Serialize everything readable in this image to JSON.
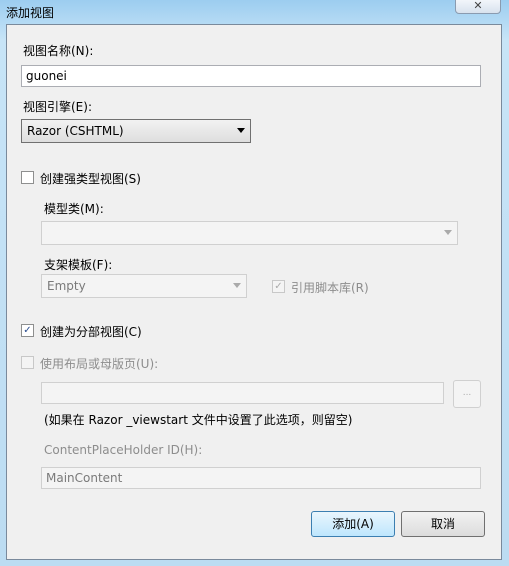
{
  "window": {
    "title": "添加视图",
    "close": "✕"
  },
  "view_name": {
    "label": "视图名称(N):",
    "value": "guonei"
  },
  "engine": {
    "label": "视图引擎(E):",
    "value": "Razor (CSHTML)"
  },
  "strong_typed": {
    "label": "创建强类型视图(S)",
    "checked": false
  },
  "model_class": {
    "label": "模型类(M):",
    "value": ""
  },
  "scaffold": {
    "label": "支架模板(F):",
    "value": "Empty"
  },
  "script_lib": {
    "label": "引用脚本库(R)",
    "checked": true,
    "check": "✓"
  },
  "partial": {
    "label": "创建为分部视图(C)",
    "checked": true,
    "check": "✓"
  },
  "layout": {
    "label": "使用布局或母版页(U):",
    "checked": false,
    "value": "",
    "browse": "...",
    "note": "(如果在 Razor _viewstart 文件中设置了此选项，则留空)"
  },
  "placeholder": {
    "label": "ContentPlaceHolder ID(H):",
    "value": "MainContent"
  },
  "buttons": {
    "add": "添加(A)",
    "cancel": "取消"
  }
}
